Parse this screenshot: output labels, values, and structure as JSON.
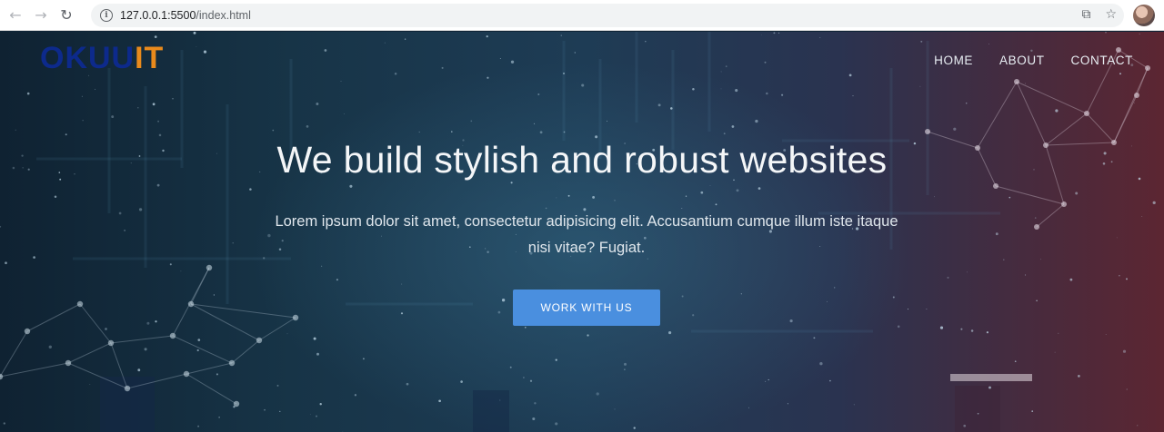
{
  "browser": {
    "url_host": "127.0.0.1:5500",
    "url_path": "/index.html",
    "back_icon": "arrow-left",
    "forward_icon": "arrow-right",
    "reload_icon": "reload",
    "share_icon": "share",
    "bookmark_icon": "star"
  },
  "site": {
    "logo_part1": "OKUU",
    "logo_part2": "IT",
    "colors": {
      "logo_primary": "#0d2a8c",
      "logo_accent": "#e98a1c",
      "button": "#4a8fdf"
    },
    "nav": [
      "HOME",
      "ABOUT",
      "CONTACT"
    ],
    "hero": {
      "headline": "We build stylish and robust websites",
      "subtitle": "Lorem ipsum dolor sit amet, consectetur adipisicing elit. Accusantium cumque illum iste itaque nisi vitae? Fugiat.",
      "button": "WORK WITH US"
    }
  }
}
